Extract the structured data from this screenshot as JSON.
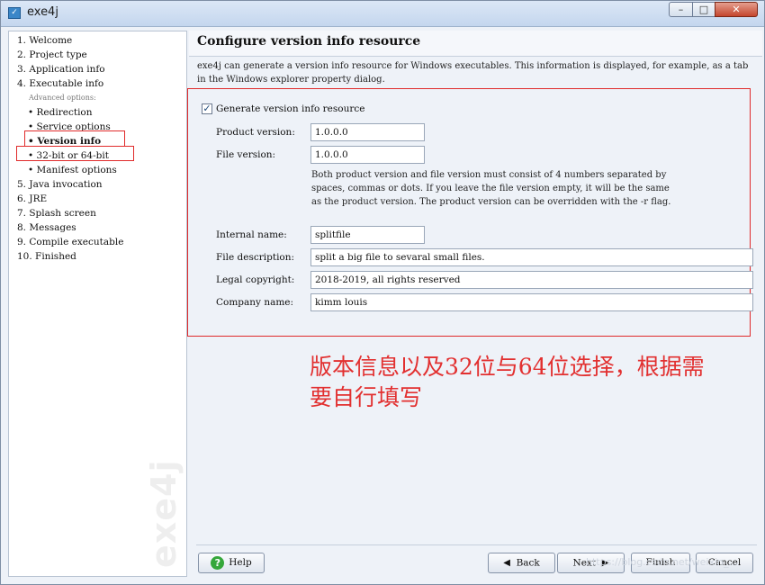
{
  "window": {
    "title": "exe4j",
    "icon": "exe4j-app-icon",
    "controls": {
      "minimize": "minimize-icon",
      "maximize": "maximize-icon",
      "close": "close-icon"
    }
  },
  "sidebar": {
    "items": [
      "1. Welcome",
      "2. Project type",
      "3. Application info",
      "4. Executable info",
      "Advanced options:",
      "• Redirection",
      "• Service options",
      "• Version info",
      "• 32-bit or 64-bit",
      "• Manifest options",
      "5. Java invocation",
      "6. JRE",
      "7. Splash screen",
      "8. Messages",
      "9. Compile executable",
      "10. Finished"
    ],
    "active_item": "• Version info",
    "watermark": "exe4j"
  },
  "page": {
    "title": "Configure version info resource",
    "description": "exe4j can generate a version info resource for Windows executables. This information is displayed, for example, as a tab in the Windows explorer property dialog."
  },
  "form": {
    "generate_checkbox": {
      "label": "Generate version info resource",
      "checked": true
    },
    "product_version": {
      "label": "Product version:",
      "value": "1.0.0.0"
    },
    "file_version": {
      "label": "File version:",
      "value": "1.0.0.0"
    },
    "version_note": [
      "Both product version and file version must consist of 4 numbers separated by",
      "spaces, commas or dots. If you leave the file version empty, it will be the same",
      "as the product version. The product version can be overridden with the -r flag."
    ],
    "internal_name": {
      "label": "Internal name:",
      "value": "splitfile"
    },
    "file_description": {
      "label": "File description:",
      "value": "split a big file to sevaral small files."
    },
    "legal_copyright": {
      "label": "Legal copyright:",
      "value": "2018-2019, all rights reserved"
    },
    "company_name": {
      "label": "Company name:",
      "value": "kimm louis"
    }
  },
  "annotation": {
    "line1": "版本信息以及32位与64位选择，根据需",
    "line2": "要自行填写",
    "color": "#e23030"
  },
  "buttons": {
    "help": "Help",
    "back": "Back",
    "next": "Next",
    "finish": "Finish",
    "cancel": "Cancel"
  },
  "footer_watermark": "https://blog.csdn.net/weixin_..."
}
